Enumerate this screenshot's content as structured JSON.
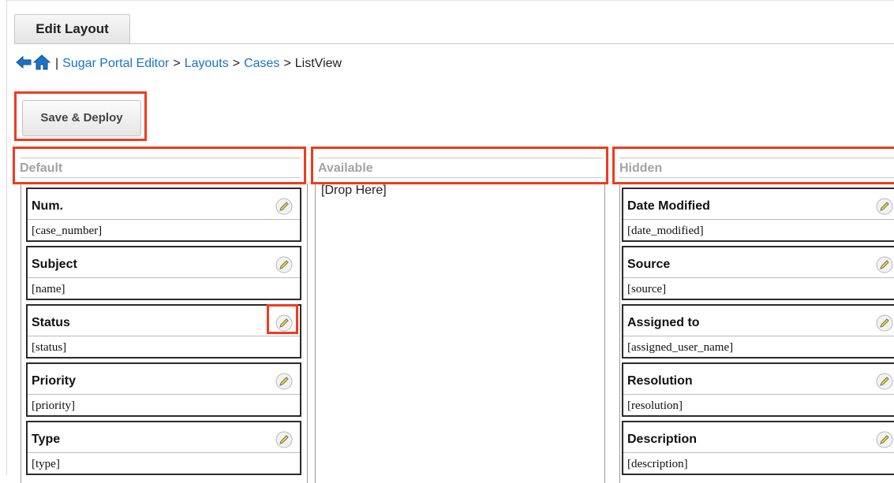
{
  "tab": {
    "label": "Edit Layout"
  },
  "breadcrumb": {
    "items": [
      "Sugar Portal Editor",
      "Layouts",
      "Cases"
    ],
    "current": "ListView",
    "separator": ">",
    "divider": "|"
  },
  "toolbar": {
    "save_label": "Save & Deploy"
  },
  "columns": {
    "default": {
      "title": "Default"
    },
    "available": {
      "title": "Available",
      "drop_text": "[Drop Here]"
    },
    "hidden": {
      "title": "Hidden"
    }
  },
  "default_fields": [
    {
      "name": "Num.",
      "id": "[case_number]"
    },
    {
      "name": "Subject",
      "id": "[name]"
    },
    {
      "name": "Status",
      "id": "[status]"
    },
    {
      "name": "Priority",
      "id": "[priority]"
    },
    {
      "name": "Type",
      "id": "[type]"
    }
  ],
  "hidden_fields": [
    {
      "name": "Date Modified",
      "id": "[date_modified]"
    },
    {
      "name": "Source",
      "id": "[source]"
    },
    {
      "name": "Assigned to",
      "id": "[assigned_user_name]"
    },
    {
      "name": "Resolution",
      "id": "[resolution]"
    },
    {
      "name": "Description",
      "id": "[description]"
    }
  ],
  "icons": {
    "back": "arrow-left-icon",
    "home": "home-icon",
    "edit": "pencil-icon"
  },
  "colors": {
    "highlight": "#f23a1d",
    "link": "#1a73c7",
    "header_text": "#a3a3a3",
    "pencil_badge": "#f2e21a"
  }
}
